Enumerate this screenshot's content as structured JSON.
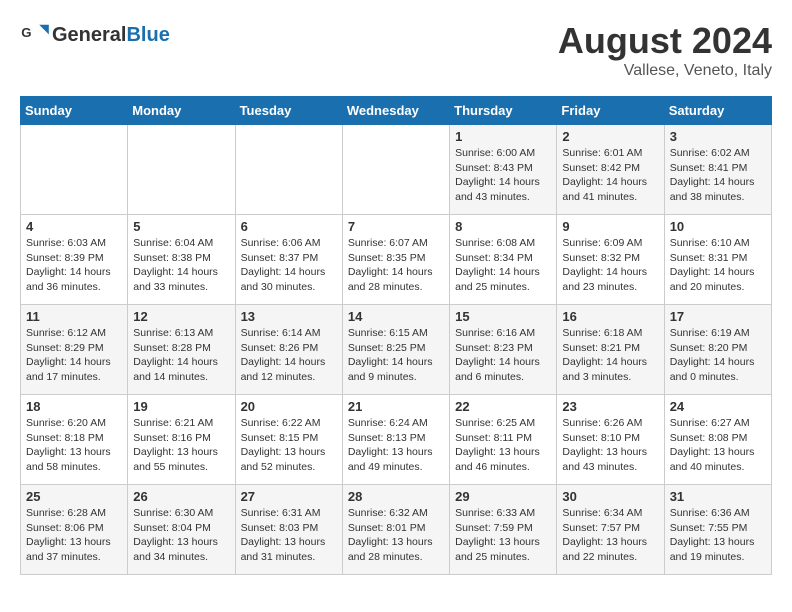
{
  "header": {
    "logo_line1": "General",
    "logo_line2": "Blue",
    "month_year": "August 2024",
    "location": "Vallese, Veneto, Italy"
  },
  "days_of_week": [
    "Sunday",
    "Monday",
    "Tuesday",
    "Wednesday",
    "Thursday",
    "Friday",
    "Saturday"
  ],
  "weeks": [
    [
      {
        "day": "",
        "content": ""
      },
      {
        "day": "",
        "content": ""
      },
      {
        "day": "",
        "content": ""
      },
      {
        "day": "",
        "content": ""
      },
      {
        "day": "1",
        "content": "Sunrise: 6:00 AM\nSunset: 8:43 PM\nDaylight: 14 hours and 43 minutes."
      },
      {
        "day": "2",
        "content": "Sunrise: 6:01 AM\nSunset: 8:42 PM\nDaylight: 14 hours and 41 minutes."
      },
      {
        "day": "3",
        "content": "Sunrise: 6:02 AM\nSunset: 8:41 PM\nDaylight: 14 hours and 38 minutes."
      }
    ],
    [
      {
        "day": "4",
        "content": "Sunrise: 6:03 AM\nSunset: 8:39 PM\nDaylight: 14 hours and 36 minutes."
      },
      {
        "day": "5",
        "content": "Sunrise: 6:04 AM\nSunset: 8:38 PM\nDaylight: 14 hours and 33 minutes."
      },
      {
        "day": "6",
        "content": "Sunrise: 6:06 AM\nSunset: 8:37 PM\nDaylight: 14 hours and 30 minutes."
      },
      {
        "day": "7",
        "content": "Sunrise: 6:07 AM\nSunset: 8:35 PM\nDaylight: 14 hours and 28 minutes."
      },
      {
        "day": "8",
        "content": "Sunrise: 6:08 AM\nSunset: 8:34 PM\nDaylight: 14 hours and 25 minutes."
      },
      {
        "day": "9",
        "content": "Sunrise: 6:09 AM\nSunset: 8:32 PM\nDaylight: 14 hours and 23 minutes."
      },
      {
        "day": "10",
        "content": "Sunrise: 6:10 AM\nSunset: 8:31 PM\nDaylight: 14 hours and 20 minutes."
      }
    ],
    [
      {
        "day": "11",
        "content": "Sunrise: 6:12 AM\nSunset: 8:29 PM\nDaylight: 14 hours and 17 minutes."
      },
      {
        "day": "12",
        "content": "Sunrise: 6:13 AM\nSunset: 8:28 PM\nDaylight: 14 hours and 14 minutes."
      },
      {
        "day": "13",
        "content": "Sunrise: 6:14 AM\nSunset: 8:26 PM\nDaylight: 14 hours and 12 minutes."
      },
      {
        "day": "14",
        "content": "Sunrise: 6:15 AM\nSunset: 8:25 PM\nDaylight: 14 hours and 9 minutes."
      },
      {
        "day": "15",
        "content": "Sunrise: 6:16 AM\nSunset: 8:23 PM\nDaylight: 14 hours and 6 minutes."
      },
      {
        "day": "16",
        "content": "Sunrise: 6:18 AM\nSunset: 8:21 PM\nDaylight: 14 hours and 3 minutes."
      },
      {
        "day": "17",
        "content": "Sunrise: 6:19 AM\nSunset: 8:20 PM\nDaylight: 14 hours and 0 minutes."
      }
    ],
    [
      {
        "day": "18",
        "content": "Sunrise: 6:20 AM\nSunset: 8:18 PM\nDaylight: 13 hours and 58 minutes."
      },
      {
        "day": "19",
        "content": "Sunrise: 6:21 AM\nSunset: 8:16 PM\nDaylight: 13 hours and 55 minutes."
      },
      {
        "day": "20",
        "content": "Sunrise: 6:22 AM\nSunset: 8:15 PM\nDaylight: 13 hours and 52 minutes."
      },
      {
        "day": "21",
        "content": "Sunrise: 6:24 AM\nSunset: 8:13 PM\nDaylight: 13 hours and 49 minutes."
      },
      {
        "day": "22",
        "content": "Sunrise: 6:25 AM\nSunset: 8:11 PM\nDaylight: 13 hours and 46 minutes."
      },
      {
        "day": "23",
        "content": "Sunrise: 6:26 AM\nSunset: 8:10 PM\nDaylight: 13 hours and 43 minutes."
      },
      {
        "day": "24",
        "content": "Sunrise: 6:27 AM\nSunset: 8:08 PM\nDaylight: 13 hours and 40 minutes."
      }
    ],
    [
      {
        "day": "25",
        "content": "Sunrise: 6:28 AM\nSunset: 8:06 PM\nDaylight: 13 hours and 37 minutes."
      },
      {
        "day": "26",
        "content": "Sunrise: 6:30 AM\nSunset: 8:04 PM\nDaylight: 13 hours and 34 minutes."
      },
      {
        "day": "27",
        "content": "Sunrise: 6:31 AM\nSunset: 8:03 PM\nDaylight: 13 hours and 31 minutes."
      },
      {
        "day": "28",
        "content": "Sunrise: 6:32 AM\nSunset: 8:01 PM\nDaylight: 13 hours and 28 minutes."
      },
      {
        "day": "29",
        "content": "Sunrise: 6:33 AM\nSunset: 7:59 PM\nDaylight: 13 hours and 25 minutes."
      },
      {
        "day": "30",
        "content": "Sunrise: 6:34 AM\nSunset: 7:57 PM\nDaylight: 13 hours and 22 minutes."
      },
      {
        "day": "31",
        "content": "Sunrise: 6:36 AM\nSunset: 7:55 PM\nDaylight: 13 hours and 19 minutes."
      }
    ]
  ]
}
